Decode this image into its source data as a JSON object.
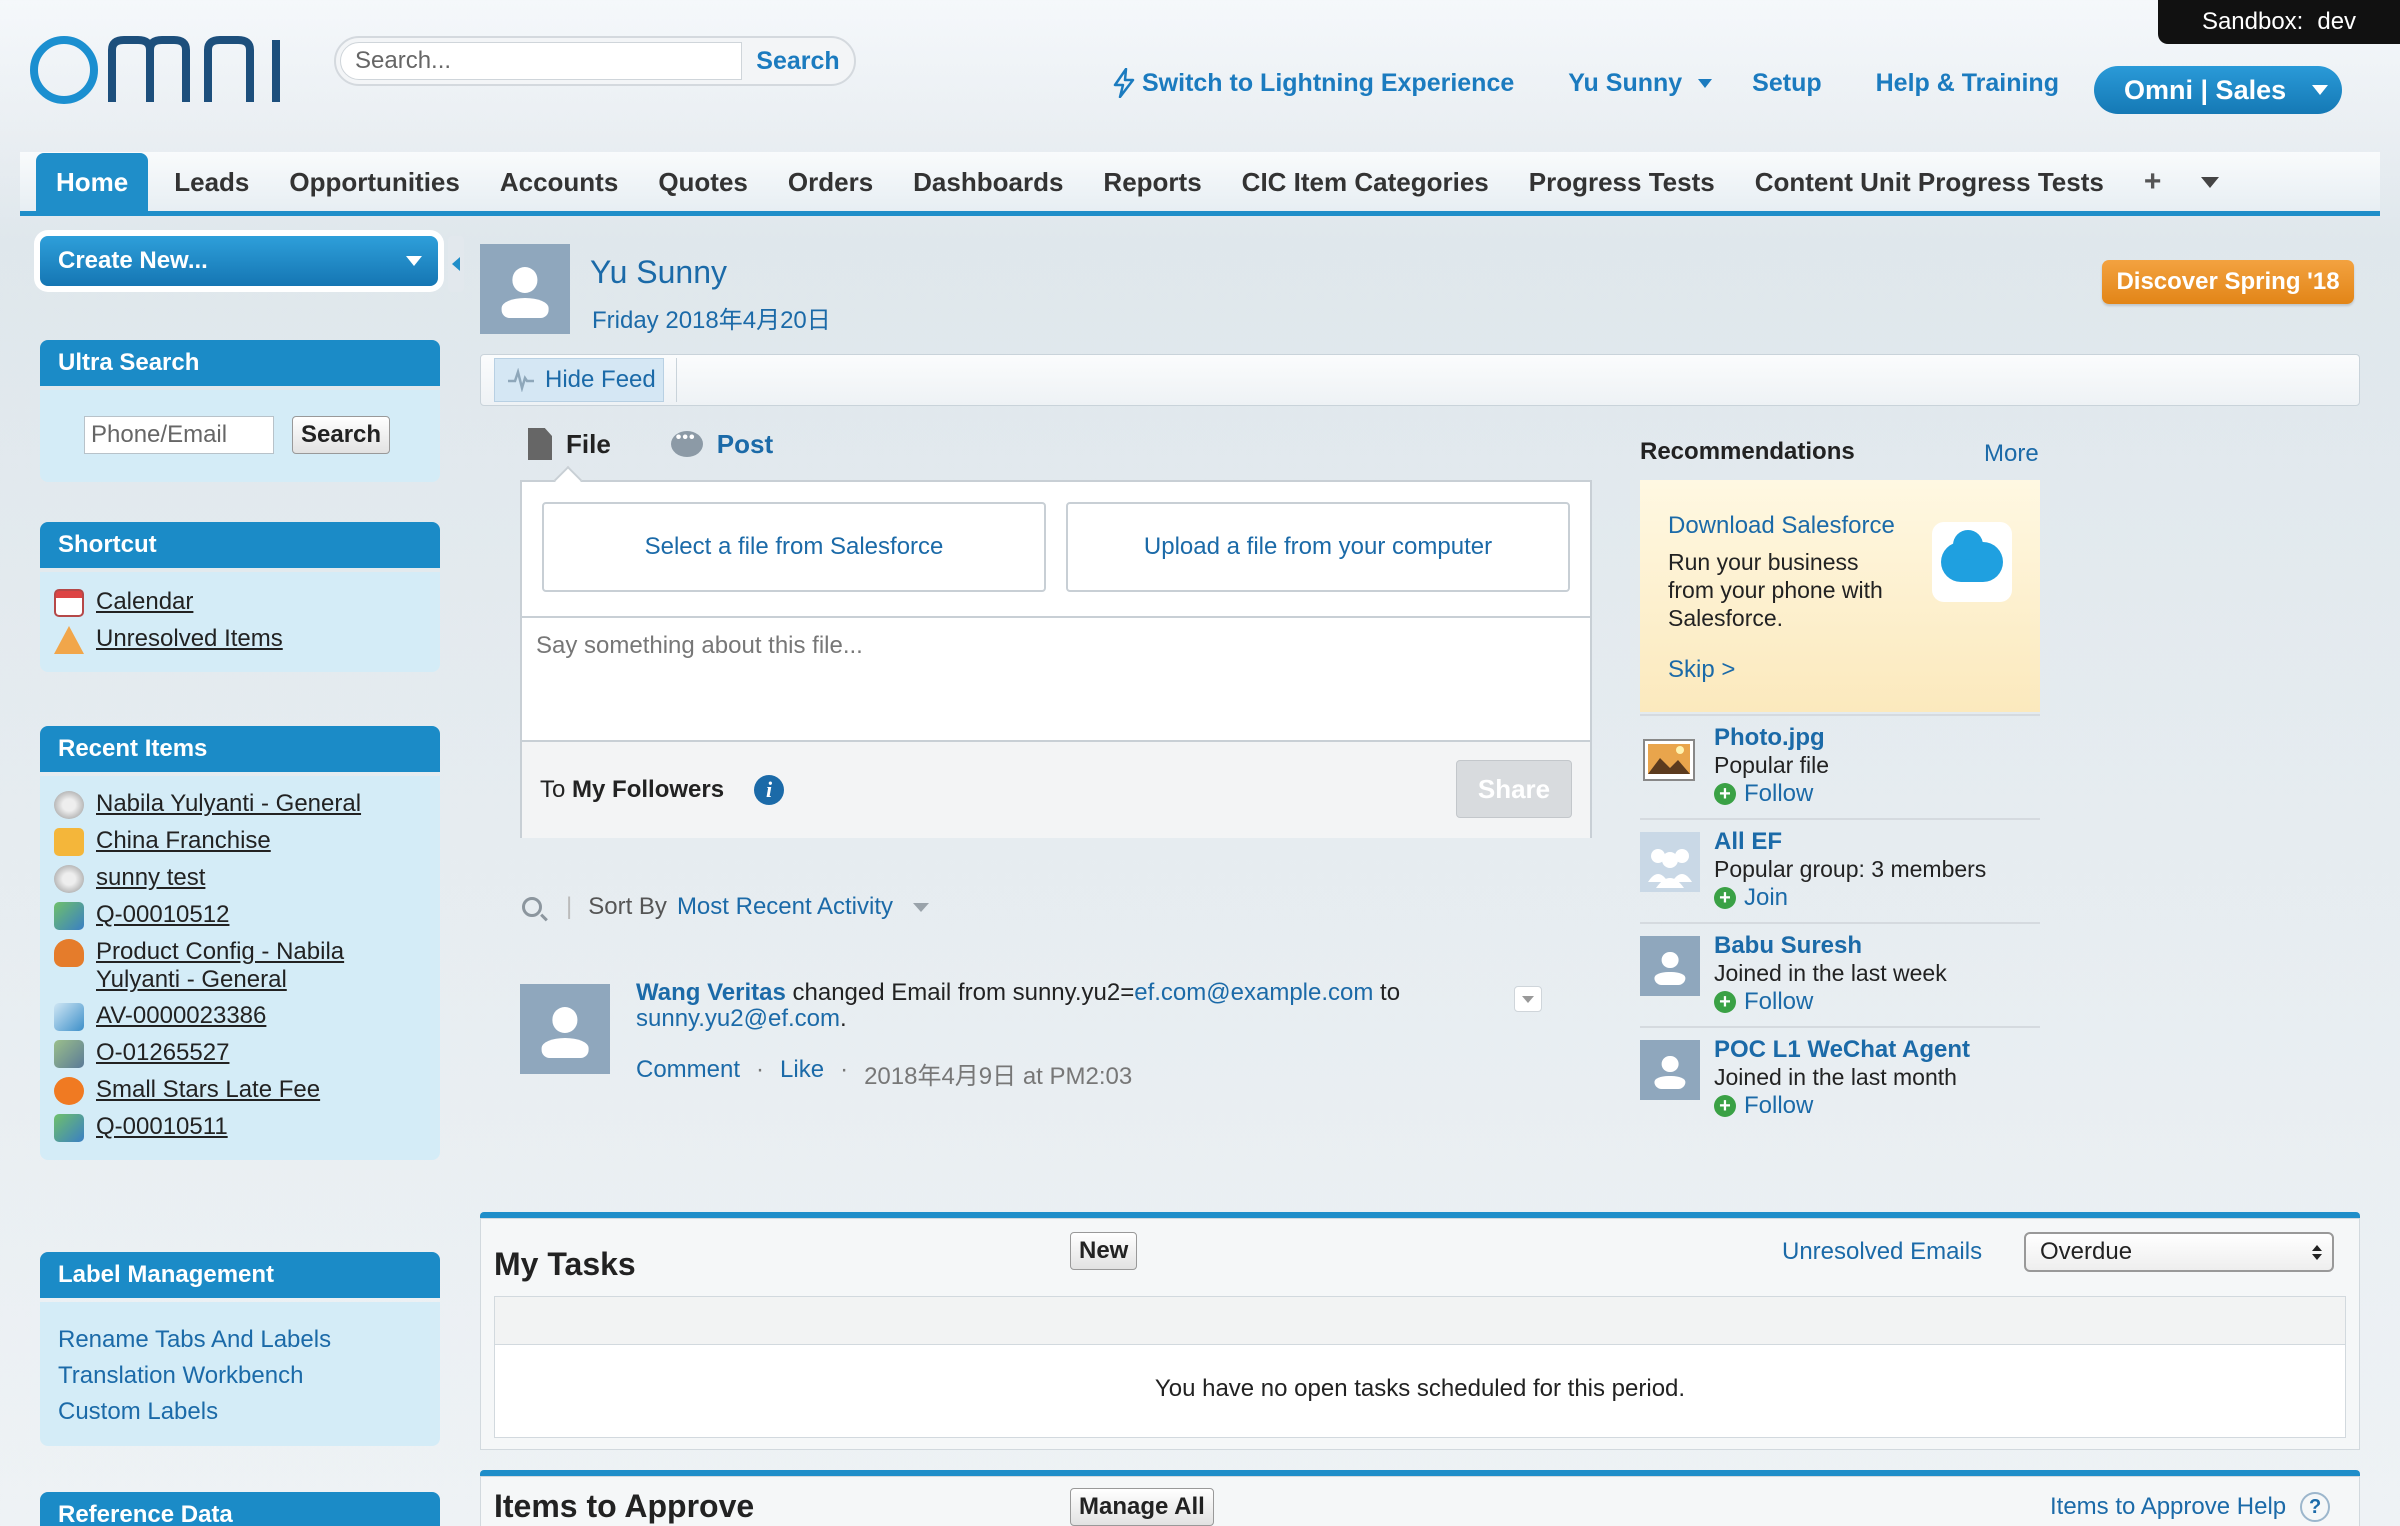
{
  "header": {
    "logo_text": "omni",
    "sandbox_label": "Sandbox:",
    "sandbox_value": "dev",
    "search_placeholder": "Search...",
    "search_button": "Search",
    "lightning_link": "Switch to Lightning Experience",
    "user_menu": "Yu Sunny",
    "setup": "Setup",
    "help": "Help & Training",
    "app_switcher": "Omni | Sales"
  },
  "tabs": [
    {
      "label": "Home",
      "active": true
    },
    {
      "label": "Leads"
    },
    {
      "label": "Opportunities"
    },
    {
      "label": "Accounts"
    },
    {
      "label": "Quotes"
    },
    {
      "label": "Orders"
    },
    {
      "label": "Dashboards"
    },
    {
      "label": "Reports"
    },
    {
      "label": "CIC Item Categories"
    },
    {
      "label": "Progress Tests"
    },
    {
      "label": "Content Unit Progress Tests"
    },
    {
      "label": "+"
    }
  ],
  "sidebar": {
    "create_new": "Create New...",
    "ultra_search": {
      "title": "Ultra Search",
      "placeholder": "Phone/Email",
      "button": "Search"
    },
    "shortcut": {
      "title": "Shortcut",
      "items": [
        {
          "label": "Calendar",
          "icon": "calendar-icon"
        },
        {
          "label": "Unresolved Items",
          "icon": "warning-icon"
        }
      ]
    },
    "recent": {
      "title": "Recent Items",
      "items": [
        {
          "label": "Nabila Yulyanti - General",
          "icon": "record-icon"
        },
        {
          "label": "China Franchise",
          "icon": "hand-icon"
        },
        {
          "label": "sunny test",
          "icon": "record-icon"
        },
        {
          "label": "Q-00010512",
          "icon": "quote-icon"
        },
        {
          "label": "Product Config - Nabila Yulyanti - General",
          "icon": "product-icon"
        },
        {
          "label": "AV-0000023386",
          "icon": "pen-icon"
        },
        {
          "label": "O-01265527",
          "icon": "order-icon"
        },
        {
          "label": "Small Stars Late Fee",
          "icon": "moon-icon"
        },
        {
          "label": "Q-00010511",
          "icon": "quote-icon"
        }
      ]
    },
    "label_mgmt": {
      "title": "Label Management",
      "links": [
        "Rename Tabs And Labels",
        "Translation Workbench",
        "Custom Labels"
      ]
    },
    "reference": {
      "title": "Reference Data"
    }
  },
  "profile": {
    "name": "Yu Sunny",
    "date": "Friday 2018年4月20日",
    "discover": "Discover Spring '18"
  },
  "feed": {
    "hide_feed": "Hide Feed",
    "tabs": {
      "file": "File",
      "post": "Post"
    },
    "select_file": "Select a file from Salesforce",
    "upload_file": "Upload a file from your computer",
    "comment_placeholder": "Say something about this file...",
    "to_label": "To",
    "followers": "My Followers",
    "share": "Share",
    "sort_by": "Sort By",
    "sort_value": "Most Recent Activity",
    "item": {
      "actor": "Wang Veritas",
      "text_before": " changed Email from sunny.yu2=",
      "old_email": "ef.com@example.com",
      "text_mid": " to ",
      "new_email": "sunny.yu2@ef.com",
      "text_end": ".",
      "comment": "Comment",
      "like": "Like",
      "dot": "·",
      "timestamp": "2018年4月9日 at PM2:03"
    }
  },
  "recommendations": {
    "title": "Recommendations",
    "more": "More",
    "promo": {
      "title": "Download Salesforce",
      "desc": "Run your business from your phone with Salesforce.",
      "skip": "Skip >"
    },
    "items": [
      {
        "name": "Photo.jpg",
        "sub": "Popular file",
        "action": "Follow",
        "thumb": "photo-icon"
      },
      {
        "name": "All EF",
        "sub": "Popular group: 3 members",
        "action": "Join",
        "thumb": "group-icon"
      },
      {
        "name": "Babu Suresh",
        "sub": "Joined in the last week",
        "action": "Follow",
        "thumb": "user-icon"
      },
      {
        "name": "POC L1 WeChat Agent",
        "sub": "Joined in the last month",
        "action": "Follow",
        "thumb": "user-icon"
      }
    ]
  },
  "tasks": {
    "title": "My Tasks",
    "new_button": "New",
    "unresolved": "Unresolved Emails",
    "filter": "Overdue",
    "empty": "You have no open tasks scheduled for this period."
  },
  "approve": {
    "title": "Items to Approve",
    "manage": "Manage All",
    "help": "Items to Approve Help",
    "help_icon": "?"
  }
}
